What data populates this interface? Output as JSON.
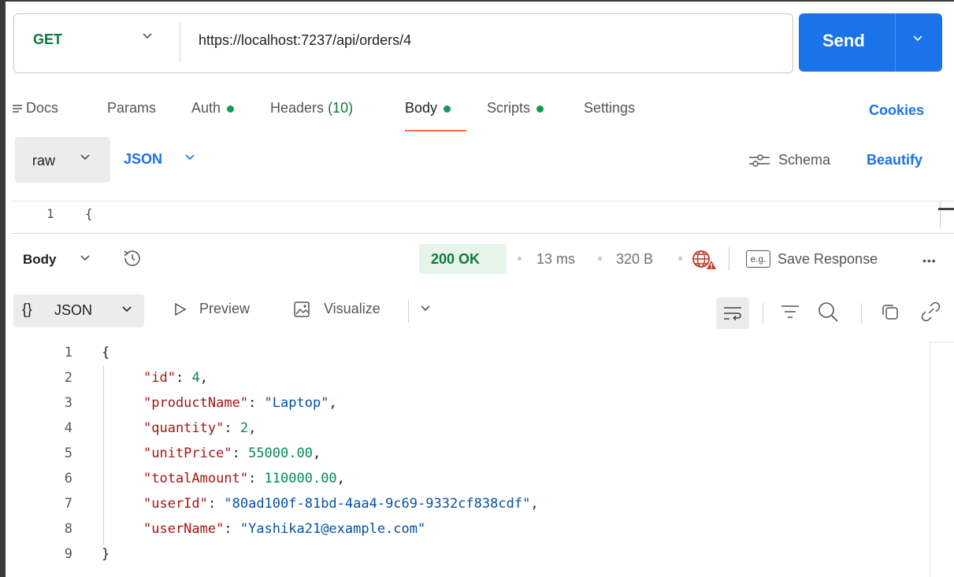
{
  "request": {
    "method": "GET",
    "url": "https://localhost:7237/api/orders/4",
    "send_label": "Send"
  },
  "tabs": {
    "docs": "Docs",
    "params": "Params",
    "auth": "Auth",
    "headers": "Headers",
    "headers_count": "(10)",
    "body": "Body",
    "scripts": "Scripts",
    "settings": "Settings",
    "cookies": "Cookies",
    "active": "Body"
  },
  "body_options": {
    "mode": "raw",
    "format": "JSON",
    "schema_label": "Schema",
    "beautify_label": "Beautify"
  },
  "request_editor": {
    "line_number": "1",
    "line_text": "{"
  },
  "response": {
    "section_label": "Body",
    "status": "200 OK",
    "time": "13 ms",
    "size": "320 B",
    "save_response_label": "Save Response",
    "eg_label": "e.g.",
    "more_icon": "•••",
    "view_mode": "JSON",
    "preview_label": "Preview",
    "visualize_label": "Visualize"
  },
  "response_json": {
    "line_numbers": [
      "1",
      "2",
      "3",
      "4",
      "5",
      "6",
      "7",
      "8",
      "9"
    ],
    "open_brace": "{",
    "close_brace": "}",
    "fields": [
      {
        "key": "\"id\"",
        "value": "4",
        "type": "number",
        "trailing": ","
      },
      {
        "key": "\"productName\"",
        "value": "\"Laptop\"",
        "type": "string",
        "trailing": ","
      },
      {
        "key": "\"quantity\"",
        "value": "2",
        "type": "number",
        "trailing": ","
      },
      {
        "key": "\"unitPrice\"",
        "value": "55000.00",
        "type": "number",
        "trailing": ","
      },
      {
        "key": "\"totalAmount\"",
        "value": "110000.00",
        "type": "number",
        "trailing": ","
      },
      {
        "key": "\"userId\"",
        "value": "\"80ad100f-81bd-4aa4-9c69-9332cf838cdf\"",
        "type": "string",
        "trailing": ","
      },
      {
        "key": "\"userName\"",
        "value": "\"Yashika21@example.com\"",
        "type": "string",
        "trailing": ""
      }
    ]
  },
  "colors": {
    "accent": "#1a73e8",
    "tab_underline": "#ff6c37",
    "status_ok": "#0b7a3c",
    "json_key": "#a31515",
    "json_number": "#098658",
    "json_string": "#0451a5"
  }
}
